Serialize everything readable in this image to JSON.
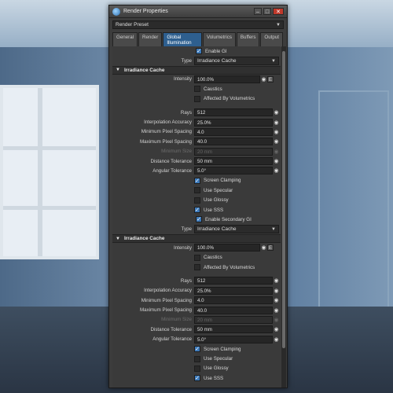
{
  "window": {
    "title": "Render Properties"
  },
  "preset": {
    "label": "Render Preset"
  },
  "tabs": [
    {
      "label": "General"
    },
    {
      "label": "Render"
    },
    {
      "label": "Global Illumination"
    },
    {
      "label": "Volumetrics"
    },
    {
      "label": "Buffers"
    },
    {
      "label": "Output"
    }
  ],
  "gi": {
    "enable_label": "Enable GI",
    "type_label": "Type",
    "type_value": "Irradiance Cache",
    "section_title": "Irradiance Cache",
    "intensity_label": "Intensity",
    "intensity_value": "100.0%",
    "e_label": "E",
    "caustics_label": "Caustics",
    "affected_label": "Affected By Volumetrics",
    "rays_label": "Rays",
    "rays_value": "512",
    "interp_label": "Interpolation Accuracy",
    "interp_value": "25.0%",
    "minpix_label": "Minimum Pixel Spacing",
    "minpix_value": "4.0",
    "maxpix_label": "Maximum Pixel Spacing",
    "maxpix_value": "40.0",
    "minsize_label": "Minimum Size",
    "minsize_value": "20 mm",
    "disttol_label": "Distance Tolerance",
    "disttol_value": "50 mm",
    "angtol_label": "Angular Tolerance",
    "angtol_value": "5.0°",
    "screen_clamp_label": "Screen Clamping",
    "specular_label": "Use Specular",
    "glossy_label": "Use Glossy",
    "sss_label": "Use SSS"
  },
  "secondary": {
    "enable_label": "Enable Secondary GI",
    "type_label": "Type",
    "type_value": "Irradiance Cache",
    "section_title": "Irradiance Cache",
    "intensity_label": "Intensity",
    "intensity_value": "100.0%",
    "e_label": "E",
    "caustics_label": "Caustics",
    "affected_label": "Affected By Volumetrics",
    "rays_label": "Rays",
    "rays_value": "512",
    "interp_label": "Interpolation Accuracy",
    "interp_value": "25.0%",
    "minpix_label": "Minimum Pixel Spacing",
    "minpix_value": "4.0",
    "maxpix_label": "Maximum Pixel Spacing",
    "maxpix_value": "40.0",
    "minsize_label": "Minimum Size",
    "minsize_value": "20 mm",
    "disttol_label": "Distance Tolerance",
    "disttol_value": "50 mm",
    "angtol_label": "Angular Tolerance",
    "angtol_value": "5.0°",
    "screen_clamp_label": "Screen Clamping",
    "specular_label": "Use Specular",
    "glossy_label": "Use Glossy",
    "sss_label": "Use SSS"
  },
  "colors": {
    "accent": "#2e5f8f",
    "check": "#3b78b8"
  },
  "icons": {
    "eye": "eye-icon",
    "collapse": "chevron-down-icon"
  }
}
